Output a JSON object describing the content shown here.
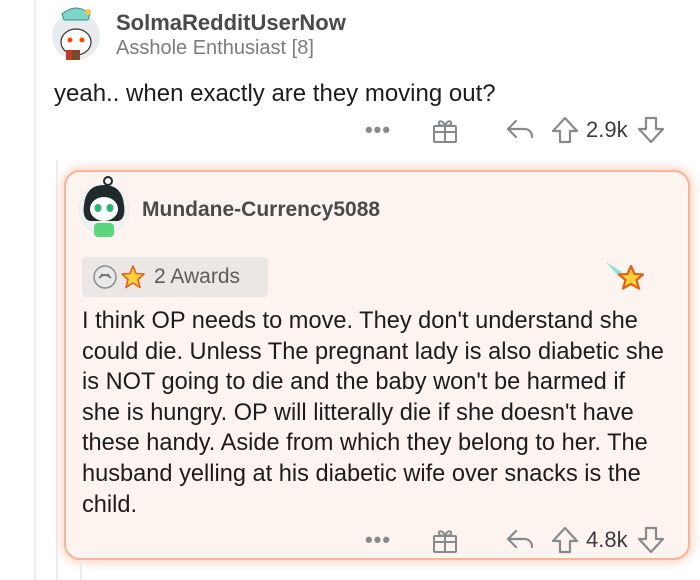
{
  "comment_parent": {
    "username": "SolmaRedditUserNow",
    "flair": "Asshole Enthusiast [8]",
    "body": "yeah.. when exactly are they moving out?",
    "actions": {
      "more_label": "•••",
      "score": "2.9k"
    }
  },
  "comment_reply": {
    "username": "Mundane-Currency5088",
    "awards_label": "2 Awards",
    "body": "I think OP needs to move. They don't understand she could die. Unless The pregnant lady is also diabetic she is NOT going to die and the baby won't be harmed if she is hungry. OP will litterally die if she doesn't have these handy. Aside from which they belong to her. The husband yelling at his diabetic wife over snacks is the child.",
    "actions": {
      "more_label": "•••",
      "score": "4.8k"
    }
  },
  "colors": {
    "card_bg": "#fef4ef",
    "card_border": "#f6b49a",
    "icon_gray": "#878a8c",
    "text": "#1c1c1c"
  },
  "icons": [
    "snoo-avatar",
    "gift-icon",
    "reply-icon",
    "upvote-icon",
    "downvote-icon",
    "award-star-icon"
  ]
}
